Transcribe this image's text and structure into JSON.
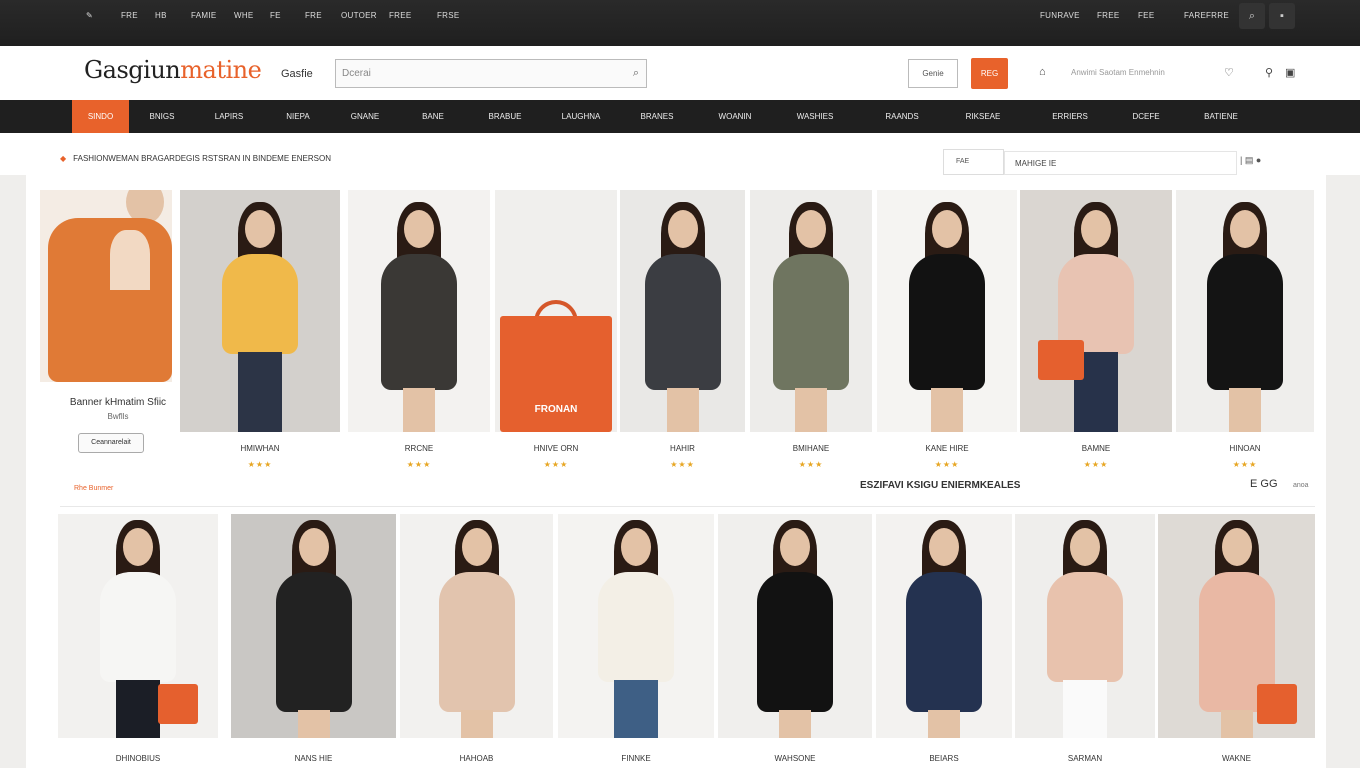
{
  "topbar": {
    "links": [
      "✎",
      "FRE",
      "HB",
      "FAMIE",
      "WHE",
      "FE",
      "FRE",
      "OUTOER",
      "FREE",
      "FRSE"
    ],
    "right_links": [
      "FUNRAVE",
      "FREE",
      "FEE",
      "FARE",
      "FRRE"
    ],
    "icons": [
      "search-icon",
      "cart-icon"
    ]
  },
  "header": {
    "logo_main": "Gasgiun",
    "logo_accent": "matine",
    "sublogo": "Gasfie",
    "search_placeholder": "Dcerai",
    "search_icon": "⌕",
    "ghost_button": "Genie",
    "orange_button": "REG",
    "links_text": "Anwimi   Saotam   Enmehnin"
  },
  "nav": {
    "items": [
      "SINDO",
      "BNIGS",
      "LAPIRS",
      "NIEPA",
      "GNANE",
      "BANE",
      "BRABUE",
      "LAUGHNA",
      "BRANES",
      "WOANIN",
      "WASHIES",
      "RAANDS",
      "RIKSEAE",
      "ERRIERS",
      "DCEFE",
      "BATIENE"
    ]
  },
  "crumb": {
    "text": "FASHIONWEMAN BRAGARDEGIS RSTSRAN  IN BINDEME ENERSON",
    "sort_label": "FAE",
    "sort_value": "MAHIGE IE"
  },
  "featured": {
    "title": "Banner kHmatim Sfiic",
    "subtitle": "Bwflls",
    "button": "Ceannarelait",
    "link": "Rhe Bunmer"
  },
  "row1": [
    {
      "name": "HMIWHAN",
      "stars": "★★★"
    },
    {
      "name": "RRCNE",
      "stars": "★★★"
    },
    {
      "name": "HNIVE ORN",
      "stars": "★★★"
    },
    {
      "name": "HAHIR",
      "stars": "★★★"
    },
    {
      "name": "BMIHANE",
      "stars": "★★★"
    },
    {
      "name": "KANE HIRE",
      "stars": "★★★"
    },
    {
      "name": "BAMNE",
      "stars": "★★★"
    },
    {
      "name": "HINOAN",
      "stars": "★★★"
    }
  ],
  "bag_label": "FRONAN",
  "section": {
    "title": "ESZIFAVI KSIGU ENIERMKEALES",
    "pager": "E  GG",
    "pager_extra": "anoa"
  },
  "row2": [
    {
      "name": "DHINOBIUS"
    },
    {
      "name": "NANS HIE"
    },
    {
      "name": "HAHOAB"
    },
    {
      "name": "FINNKE"
    },
    {
      "name": "WAHSONE"
    },
    {
      "name": "BEIARS"
    },
    {
      "name": "SARMAN"
    },
    {
      "name": "WAKNE"
    }
  ],
  "colors": {
    "accent": "#e8622b",
    "dark": "#1f1f1f",
    "star": "#e7a623"
  }
}
